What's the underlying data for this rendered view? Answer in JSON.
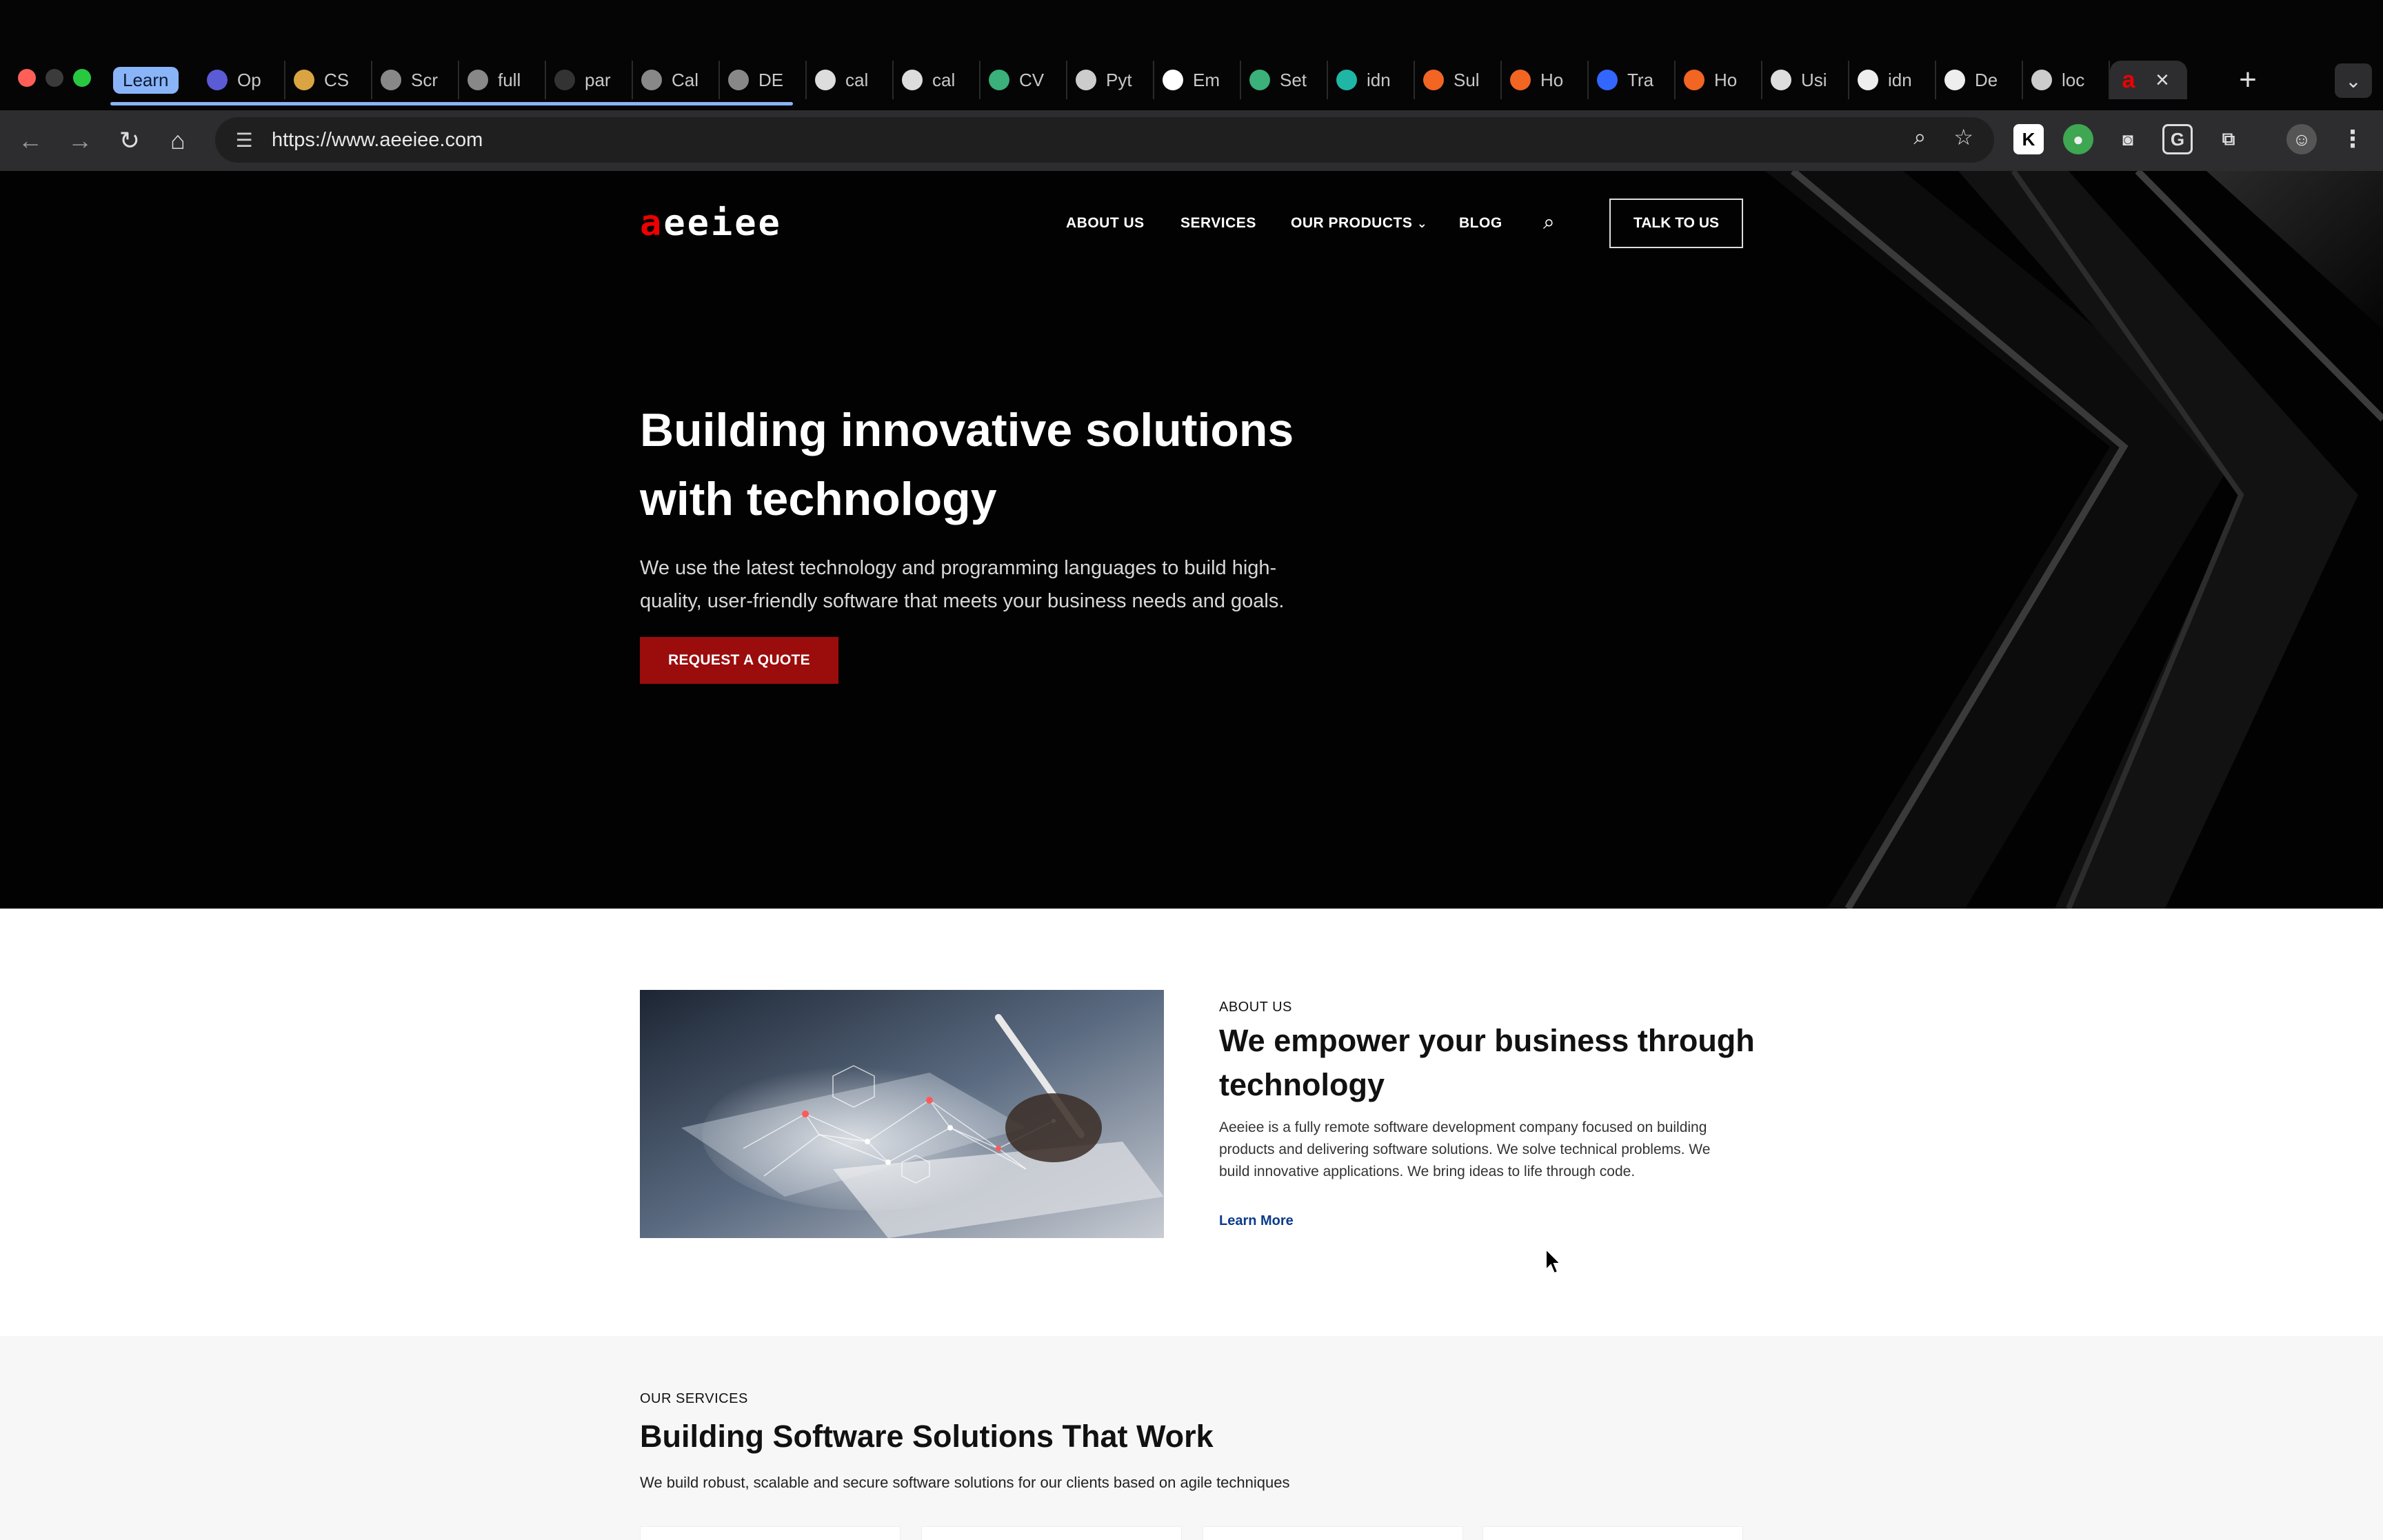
{
  "browser": {
    "tab_group_label": "Learn",
    "tabs": [
      {
        "label": "Op",
        "icon": "openai-icon",
        "color": "#5b5bd6"
      },
      {
        "label": "CS",
        "icon": "hand-icon",
        "color": "#d9a441"
      },
      {
        "label": "Scr",
        "icon": "globe-icon",
        "color": "#888888"
      },
      {
        "label": "full",
        "icon": "globe-icon",
        "color": "#888888"
      },
      {
        "label": "par",
        "icon": "github-icon",
        "color": "#333333"
      },
      {
        "label": "Cal",
        "icon": "globe-icon",
        "color": "#888888"
      },
      {
        "label": "DE",
        "icon": "globe-icon",
        "color": "#888888"
      },
      {
        "label": "cal",
        "icon": "site-icon",
        "color": "#dddddd"
      },
      {
        "label": "cal",
        "icon": "site-icon",
        "color": "#dddddd"
      },
      {
        "label": "CV",
        "icon": "bolt-icon",
        "color": "#3bb07a"
      },
      {
        "label": "Pyt",
        "icon": "bolt-icon",
        "color": "#cccccc"
      },
      {
        "label": "Em",
        "icon": "r-icon",
        "color": "#ffffff"
      },
      {
        "label": "Set",
        "icon": "bolt-icon",
        "color": "#3bb07a"
      },
      {
        "label": "idn",
        "icon": "diamond-icon",
        "color": "#1fb6a6"
      },
      {
        "label": "Sul",
        "icon": "wave-icon",
        "color": "#f26522"
      },
      {
        "label": "Ho",
        "icon": "wave-icon",
        "color": "#f26522"
      },
      {
        "label": "Tra",
        "icon": "mail-icon",
        "color": "#3366ff"
      },
      {
        "label": "Ho",
        "icon": "wave-icon",
        "color": "#f26522"
      },
      {
        "label": "Usi",
        "icon": "site-icon",
        "color": "#dddddd"
      },
      {
        "label": "idn",
        "icon": "github-icon",
        "color": "#eeeeee"
      },
      {
        "label": "De",
        "icon": "github-icon",
        "color": "#eeeeee"
      },
      {
        "label": "loc",
        "icon": "avatar-icon",
        "color": "#cccccc"
      }
    ],
    "active_tab_icon": "a",
    "url": "https://www.aeeiee.com"
  },
  "site": {
    "logo_accent": "a",
    "logo_rest": "eeiee",
    "nav": {
      "about": "ABOUT US",
      "services": "SERVICES",
      "products": "OUR PRODUCTS",
      "blog": "BLOG",
      "cta": "TALK TO US"
    },
    "hero": {
      "title": "Building innovative solutions with technology",
      "subtitle": "We use the latest technology and programming languages to build high-quality, user-friendly software that meets your business needs and goals.",
      "button": "REQUEST A QUOTE"
    },
    "about": {
      "eyebrow": "ABOUT US",
      "title": "We empower your business through technology",
      "text": "Aeeiee is a fully remote software development company focused on building products and delivering software solutions. We solve technical problems. We build innovative applications. We bring ideas to life through code.",
      "link": "Learn More"
    },
    "services": {
      "eyebrow": "OUR SERVICES",
      "title": "Building Software Solutions That Work",
      "subtitle": "We build robust, scalable and secure software solutions for our clients based on agile techniques"
    }
  },
  "colors": {
    "accent_red": "#9b0c0c",
    "logo_red": "#ee0000",
    "link_blue": "#0b3b8c",
    "tab_group_blue": "#8ab4f8"
  }
}
